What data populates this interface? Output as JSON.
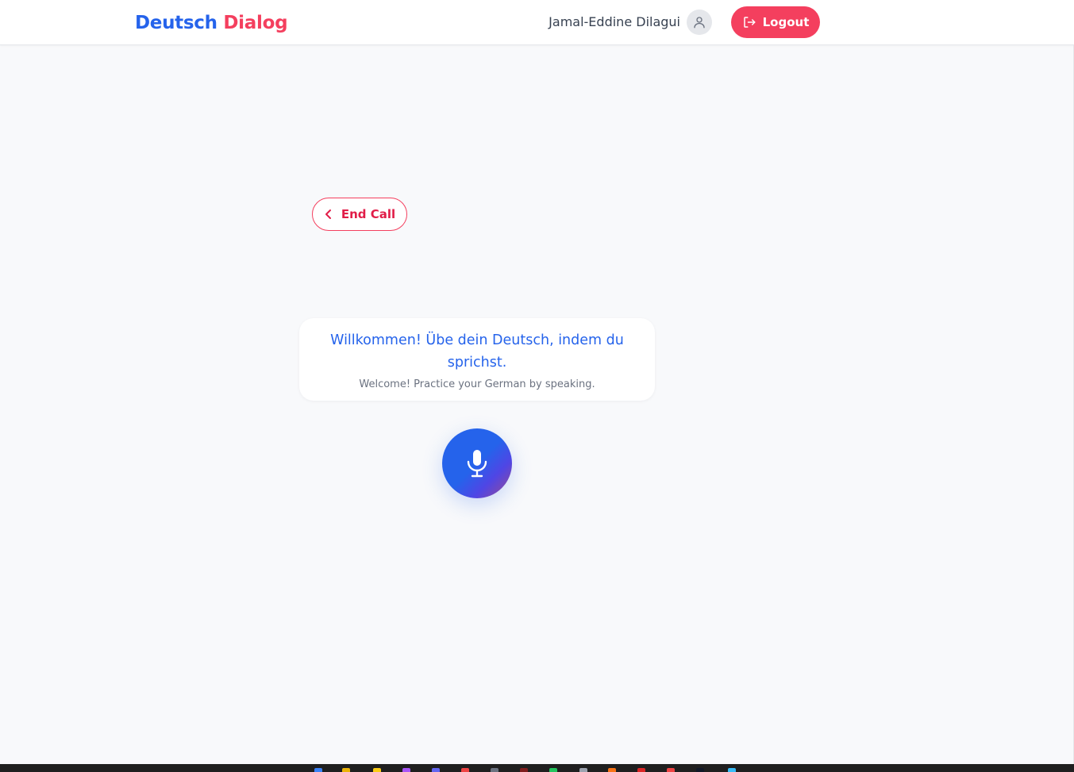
{
  "header": {
    "brand_part1": "Deutsch",
    "brand_part2": "Dialog",
    "user_name": "Jamal-Eddine Dilagui",
    "logout_label": "Logout"
  },
  "call": {
    "end_call_label": "End Call"
  },
  "welcome": {
    "german": "Willkommen! Übe dein Deutsch, indem du sprichst.",
    "english": "Welcome! Practice your German by speaking."
  },
  "colors": {
    "primary": "#2563eb",
    "accent": "#f43f5e",
    "background": "#f8f9fb"
  },
  "icons": {
    "avatar": "user-icon",
    "logout": "logout-icon",
    "end_call": "chevron-left-icon",
    "mic": "microphone-icon"
  }
}
